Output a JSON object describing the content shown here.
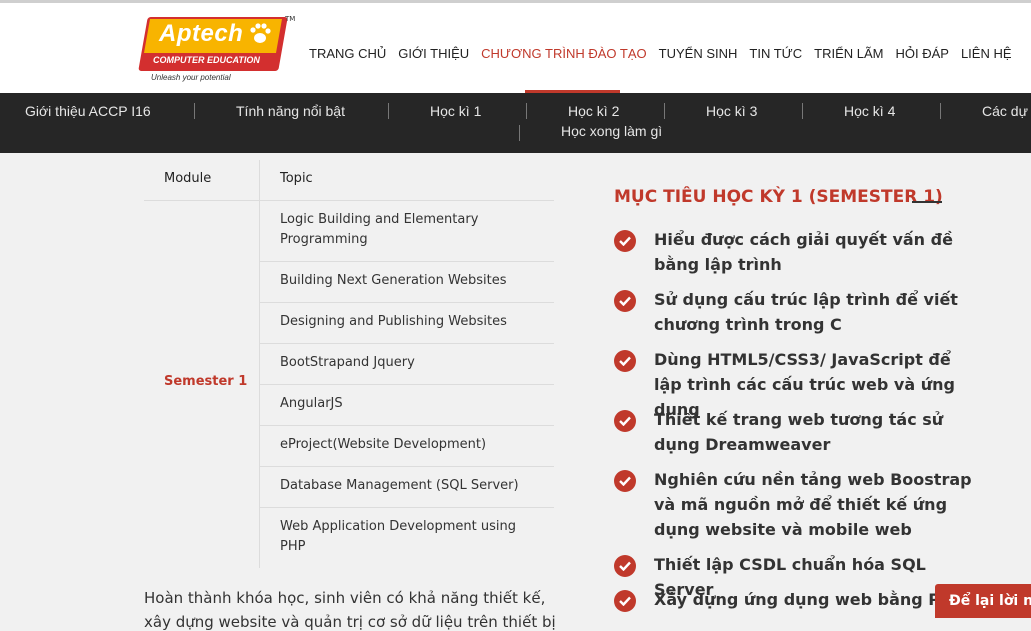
{
  "brand": {
    "name": "Aptech",
    "tagline": "COMPUTER EDUCATION",
    "slogan": "Unleash your potential",
    "trademark": "TM",
    "colors": {
      "red": "#c0392b",
      "yellow": "#f8b400"
    }
  },
  "top_nav": {
    "items": [
      "TRANG CHỦ",
      "GIỚI THIỆU",
      "CHƯƠNG TRÌNH ĐÀO TẠO",
      "TUYỂN SINH",
      "TIN TỨC",
      "TRIỂN LÃM",
      "HỎI ĐÁP",
      "LIÊN HỆ"
    ],
    "active": "CHƯƠNG TRÌNH ĐÀO TẠO"
  },
  "sub_nav": {
    "items": [
      "Giới thiệu ACCP I16",
      "Tính năng nổi bật",
      "Học kì 1",
      "Học kì 2",
      "Học kì 3",
      "Học kì 4",
      "Các dự á",
      "Học xong làm gì"
    ],
    "active": "Học kì 2"
  },
  "table": {
    "headers": {
      "module": "Module",
      "topic": "Topic"
    },
    "semester": "Semester 1",
    "topics": [
      "Logic Building and Elementary Programming",
      "Building Next Generation Websites",
      "Designing and Publishing Websites",
      "BootStrapand Jquery",
      "AngularJS",
      "eProject(Website Development)",
      "Database Management (SQL Server)",
      "Web Application Development using PHP"
    ]
  },
  "paragraph": {
    "line1": "Hoàn thành khóa học, sinh viên có khả năng thiết kế,",
    "line2": "xây dựng website và quản trị cơ sở dữ liệu trên thiết bị"
  },
  "goals": {
    "title": "MỤC TIÊU HỌC KỲ 1 (SEMESTER 1)",
    "items": [
      "Hiểu được cách giải quyết vấn đề bằng lập trình",
      "Sử dụng cấu trúc lập trình để viết chương trình trong C",
      "Dùng HTML5/CSS3/ JavaScript để lập trình các cấu trúc web và ứng dụng",
      "Thiết kế trang web tương tác sử dụng Dreamweaver",
      "Nghiên cứu nền tảng web Boostrap và mã nguồn mở để thiết kế ứng dụng website và mobile web",
      "Thiết lập CSDL chuẩn hóa SQL Server",
      "Xây dựng ứng dụng web bằng PHP"
    ]
  },
  "cta": {
    "label": "Để lại lời nh"
  }
}
